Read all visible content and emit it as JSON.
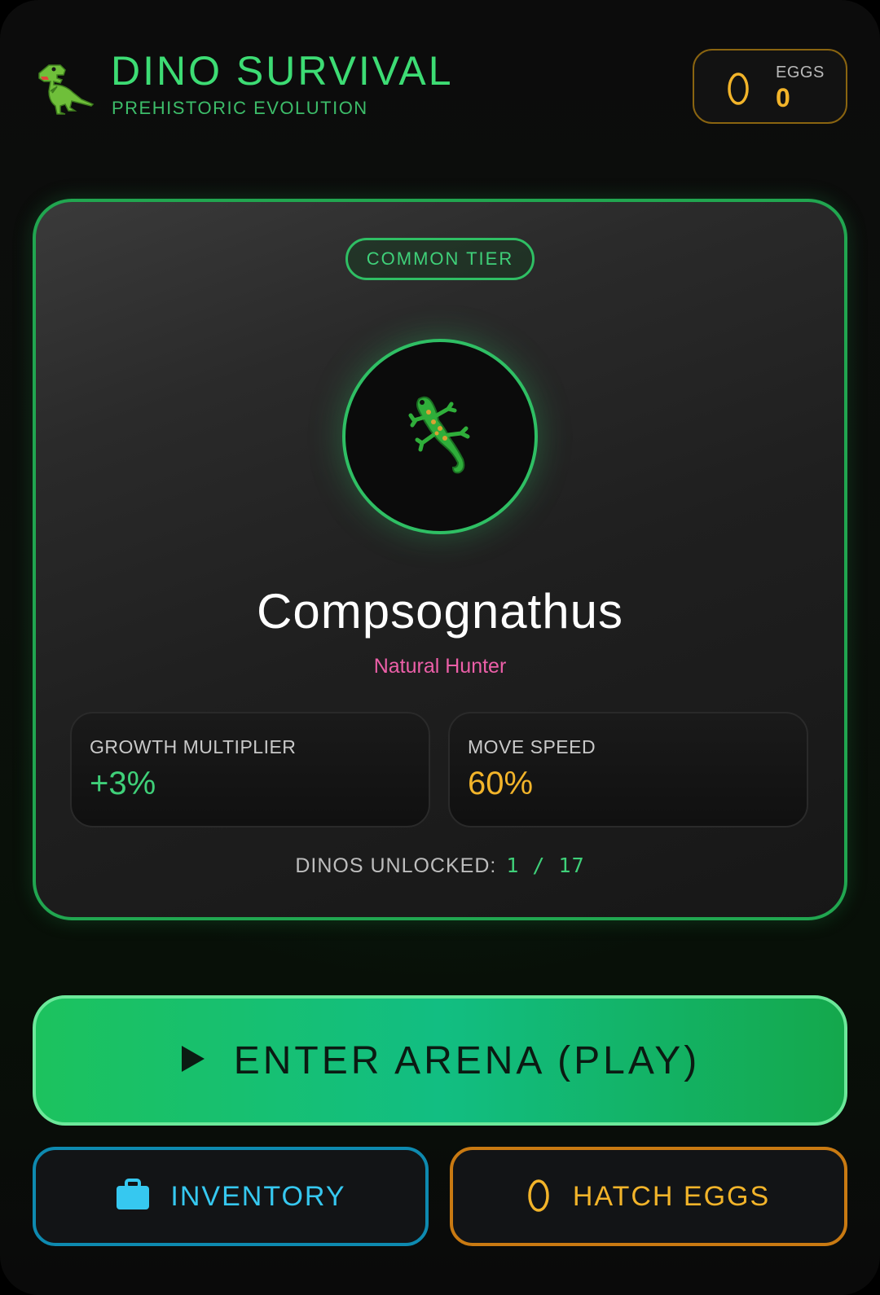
{
  "header": {
    "title": "DINO SURVIVAL",
    "subtitle": "PREHISTORIC EVOLUTION",
    "logo_icon": "t-rex-icon",
    "eggs_label": "EGGS",
    "eggs_count": "0",
    "eggs_icon": "egg-icon"
  },
  "card": {
    "tier": "COMMON TIER",
    "avatar_icon": "lizard-icon",
    "dino_name": "Compsognathus",
    "dino_trait": "Natural Hunter",
    "stats": {
      "growth_label": "GROWTH MULTIPLIER",
      "growth_value": "+3%",
      "speed_label": "MOVE SPEED",
      "speed_value": "60%"
    },
    "unlocked_label": "DINOS UNLOCKED:",
    "unlocked_value": "1 / 17"
  },
  "actions": {
    "play_label": "ENTER ARENA (PLAY)",
    "inventory_label": "INVENTORY",
    "hatch_label": "HATCH EGGS"
  },
  "colors": {
    "accent_green": "#3ddc74",
    "accent_gold": "#f2b42a",
    "accent_cyan": "#36c8f0",
    "trait_pink": "#ec5fa8"
  }
}
